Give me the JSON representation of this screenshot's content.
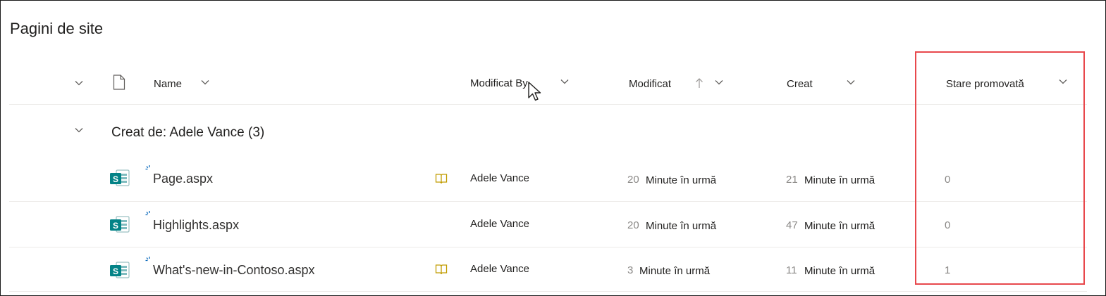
{
  "page_title": "Pagini de site",
  "columns": {
    "name": "Name",
    "modified_by": "Modificat By",
    "modified": "Modificat",
    "created": "Creat",
    "promoted_state": "Stare promovată"
  },
  "group": {
    "label": "Creat de: Adele Vance (3)"
  },
  "rows": [
    {
      "file_name": "Page.aspx",
      "has_book_icon": true,
      "modified_by": "Adele Vance",
      "modified_num": "20",
      "modified_text": "Minute în urmă",
      "created_num": "21",
      "created_text": "Minute în urmă",
      "promoted_state": "0"
    },
    {
      "file_name": "Highlights.aspx",
      "has_book_icon": false,
      "modified_by": "Adele Vance",
      "modified_num": "20",
      "modified_text": "Minute în urmă",
      "created_num": "47",
      "created_text": "Minute în urmă",
      "promoted_state": "0"
    },
    {
      "file_name": "What's-new-in-Contoso.aspx",
      "has_book_icon": true,
      "modified_by": "Adele Vance",
      "modified_num": "3",
      "modified_text": "Minute în urmă",
      "created_num": "11",
      "created_text": "Minute în urmă",
      "promoted_state": "1"
    }
  ],
  "colors": {
    "highlight_box": "#e8484c",
    "sharepoint_green": "#038387",
    "book_icon": "#c19c00",
    "new_spark": "#0f6cbd"
  }
}
